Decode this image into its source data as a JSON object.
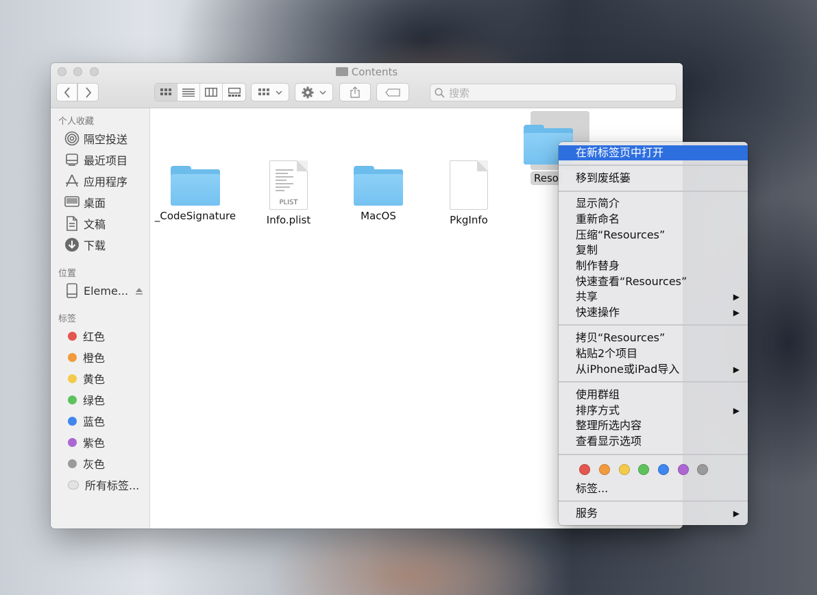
{
  "window": {
    "title": "Contents",
    "search_placeholder": "搜索"
  },
  "sidebar": {
    "favorites_header": "个人收藏",
    "favorites": [
      {
        "label": "隔空投送",
        "icon": "airdrop-icon"
      },
      {
        "label": "最近项目",
        "icon": "recents-icon"
      },
      {
        "label": "应用程序",
        "icon": "applications-icon"
      },
      {
        "label": "桌面",
        "icon": "desktop-icon"
      },
      {
        "label": "文稿",
        "icon": "documents-icon"
      },
      {
        "label": "下载",
        "icon": "downloads-icon"
      }
    ],
    "locations_header": "位置",
    "locations": [
      {
        "label": "Eleme...",
        "icon": "disk-icon"
      }
    ],
    "tags_header": "标签",
    "tags": [
      {
        "label": "红色",
        "color": "#e5554f"
      },
      {
        "label": "橙色",
        "color": "#f19b3c"
      },
      {
        "label": "黄色",
        "color": "#f4ca4a"
      },
      {
        "label": "绿色",
        "color": "#5dc25e"
      },
      {
        "label": "蓝色",
        "color": "#3f86ef"
      },
      {
        "label": "紫色",
        "color": "#ac66d3"
      },
      {
        "label": "灰色",
        "color": "#9a9a9a"
      },
      {
        "label": "所有标签...",
        "color": "#e0e0e0"
      }
    ]
  },
  "files": [
    {
      "name": "_CodeSignature",
      "type": "folder"
    },
    {
      "name": "Info.plist",
      "type": "plist",
      "tag": "PLIST"
    },
    {
      "name": "MacOS",
      "type": "folder"
    },
    {
      "name": "PkgInfo",
      "type": "file"
    },
    {
      "name": "Reso",
      "type": "folder",
      "selected": true
    }
  ],
  "context_menu": {
    "items": {
      "open_new_tab": "在新标签页中打开",
      "move_to_trash": "移到废纸篓",
      "get_info": "显示简介",
      "rename": "重新命名",
      "compress": "压缩“Resources”",
      "duplicate": "复制",
      "make_alias": "制作替身",
      "quick_look": "快速查看“Resources”",
      "share": "共享",
      "quick_actions": "快速操作",
      "copy": "拷贝“Resources”",
      "paste": "粘贴2个项目",
      "import": "从iPhone或iPad导入",
      "use_groups": "使用群组",
      "sort_by": "排序方式",
      "clean_up": "整理所选内容",
      "view_options": "查看显示选项",
      "tags": "标签...",
      "services": "服务"
    },
    "submenu_arrow": "▶",
    "tag_colors": [
      "#e5554f",
      "#f19b3c",
      "#f4ca4a",
      "#5dc25e",
      "#3f86ef",
      "#ac66d3",
      "#9a9a9a"
    ]
  }
}
